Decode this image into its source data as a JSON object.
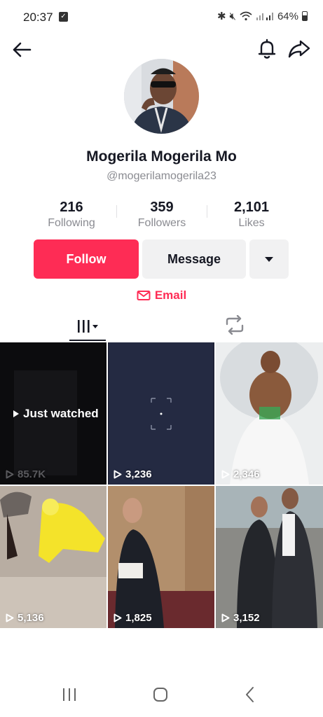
{
  "status_bar": {
    "time": "20:37",
    "battery": "64%"
  },
  "profile": {
    "display_name": "Mogerila Mogerila Mo",
    "username": "@mogerilamogerila23"
  },
  "stats": [
    {
      "value": "216",
      "label": "Following"
    },
    {
      "value": "359",
      "label": "Followers"
    },
    {
      "value": "2,101",
      "label": "Likes"
    }
  ],
  "actions": {
    "follow_label": "Follow",
    "message_label": "Message",
    "email_label": "Email"
  },
  "videos": [
    {
      "views": "85.7K",
      "badge": "Just watched"
    },
    {
      "views": "3,236"
    },
    {
      "views": "2,346"
    },
    {
      "views": "5,136"
    },
    {
      "views": "1,825"
    },
    {
      "views": "3,152"
    }
  ],
  "colors": {
    "accent": "#fe2c55",
    "text": "#161823",
    "muted": "#8a8b91"
  },
  "icons": [
    "back-arrow-icon",
    "bell-icon",
    "share-icon",
    "caret-down-icon",
    "mail-icon",
    "grid-icon",
    "repost-icon",
    "play-icon",
    "recent-apps-icon",
    "home-icon",
    "nav-back-icon"
  ]
}
